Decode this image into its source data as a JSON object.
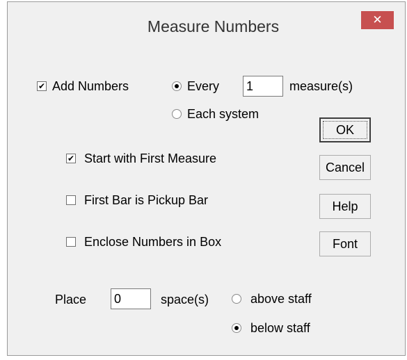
{
  "window": {
    "title": "Measure Numbers",
    "close_glyph": "✕"
  },
  "add_numbers": {
    "label": "Add Numbers",
    "checked": true
  },
  "frequency": {
    "every_label": "Every",
    "every_value": "1",
    "unit_label": "measure(s)",
    "each_system_label": "Each system",
    "selected": "every"
  },
  "options": [
    {
      "label": "Start with First Measure",
      "checked": true
    },
    {
      "label": "First Bar is Pickup Bar",
      "checked": false
    },
    {
      "label": "Enclose Numbers in Box",
      "checked": false
    }
  ],
  "placement": {
    "place_label": "Place",
    "value": "0",
    "unit_label": "space(s)",
    "above_label": "above staff",
    "below_label": "below staff",
    "selected": "below"
  },
  "buttons": {
    "ok": "OK",
    "cancel": "Cancel",
    "help": "Help",
    "font": "Font"
  }
}
